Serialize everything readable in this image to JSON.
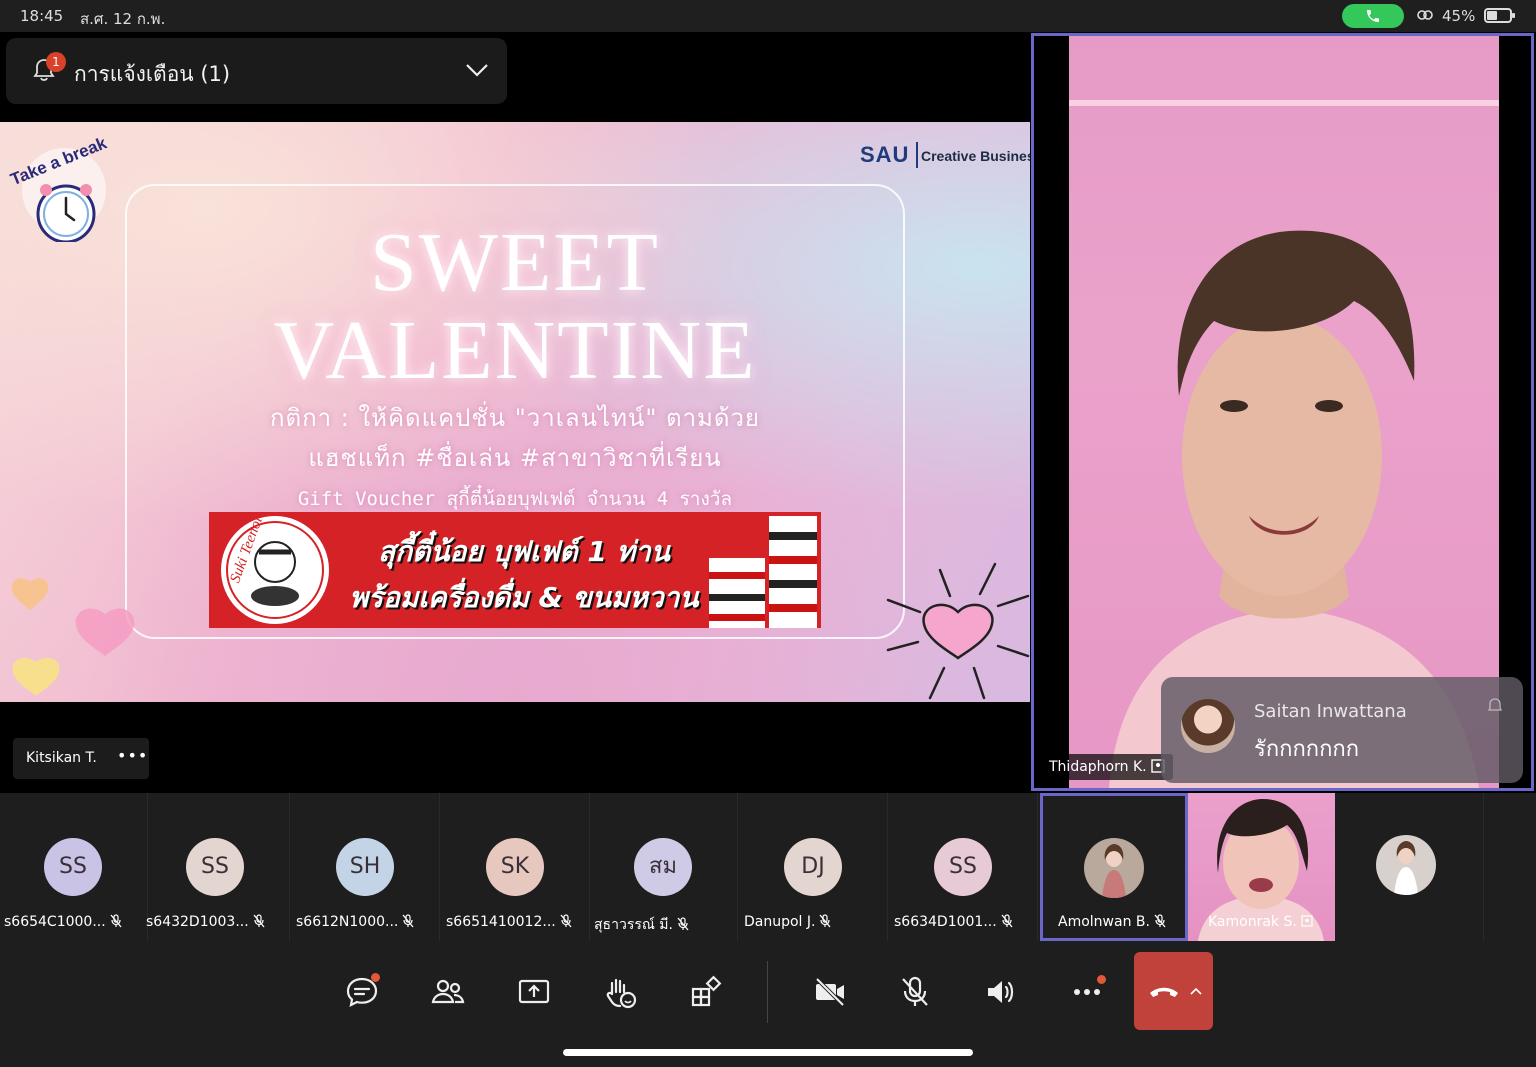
{
  "status_bar": {
    "time": "18:45",
    "date": "ส.ศ. 12 ก.พ.",
    "battery_text": "45%",
    "battery_level": 0.45
  },
  "notification": {
    "badge_count": "1",
    "label": "การแจ้งเตือน (1)"
  },
  "slide": {
    "badge_text": "Take a break",
    "brand_logo": "SAU",
    "brand_text": "Creative BusinessClass",
    "title_line1": "SWEET",
    "title_line2": "VALENTINE",
    "rule_line1": "กติกา  :  ให้คิดแคปชั่น \"วาเลนไทน์\" ตามด้วย",
    "rule_line2": "แฮชแท็ก #ชื่อเล่น #สาขาวิชาที่เรียน",
    "gift_line": "Gift Voucher สุกี้ตี๋น้อยบุฟเฟต์ จำนวน 4 รางวัล",
    "banner_line1": "สุกี้ตี๋น้อย บุฟเฟต์ 1 ท่าน",
    "banner_line2": "พร้อมเครื่องดื่ม & ขนมหวาน",
    "banner_logo_text": "Suki Teenoi"
  },
  "presenter": {
    "name": "Kitsikan T.",
    "more": "•••"
  },
  "main_video": {
    "name": "Thidaphorn K."
  },
  "chat_toast": {
    "sender": "Saitan Inwattana",
    "message": "รักกกกกกก"
  },
  "participants": [
    {
      "initials": "SS",
      "name": "s6654C1000...",
      "color": "#c9c3e6"
    },
    {
      "initials": "SS",
      "name": "s6432D1003...",
      "color": "#e3d6d0"
    },
    {
      "initials": "SH",
      "name": "s6612N1000...",
      "color": "#c3d4e6"
    },
    {
      "initials": "SK",
      "name": "s6651410012...",
      "color": "#e6c8bf"
    },
    {
      "initials": "สม",
      "name": "สุธาวรรณ์ มี.",
      "color": "#cfcbe6"
    },
    {
      "initials": "DJ",
      "name": "Danupol J.",
      "color": "#e3d6d0"
    },
    {
      "initials": "SS",
      "name": "s6634D1001...",
      "color": "#e6cbd6"
    },
    {
      "initials": "",
      "name": "Amolnwan B.",
      "color": "#b9a89c"
    },
    {
      "initials": "",
      "name": "Kamonrak S.",
      "color": "#e592c2"
    },
    {
      "initials": "",
      "name": "",
      "color": "#d8d0cc"
    }
  ],
  "controls": {
    "chat_icon": "chat-icon",
    "people_icon": "people-icon",
    "share_icon": "share-screen-icon",
    "raise_hand_icon": "raise-hand-icon",
    "apps_icon": "apps-icon",
    "camera_off_icon": "camera-off-icon",
    "mic_off_icon": "mic-off-icon",
    "speaker_icon": "speaker-icon",
    "more_icon": "more-icon",
    "hangup_icon": "hang-up-icon"
  }
}
